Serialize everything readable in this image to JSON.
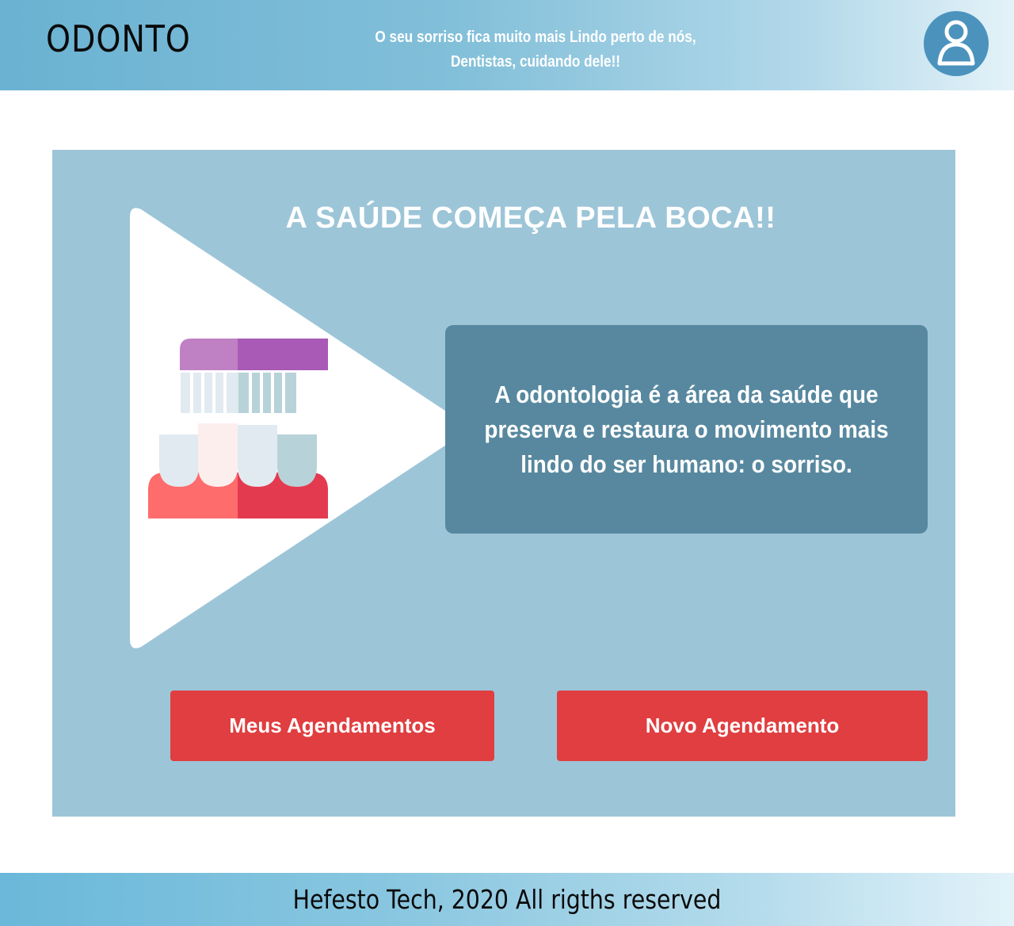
{
  "header": {
    "brand": "ODONTO",
    "tagline_line1": "O seu sorriso fica muito mais Lindo perto de nós,",
    "tagline_line2": "Dentistas, cuidando dele!!",
    "avatar_icon": "user-avatar-icon"
  },
  "main": {
    "headline": "A SAÚDE COMEÇA PELA BOCA!!",
    "illustration_icon": "toothbrush-teeth-icon",
    "info_text": "A odontologia é a área da saúde que preserva e restaura o movimento mais lindo do ser humano: o sorriso.",
    "buttons": {
      "meus": "Meus Agendamentos",
      "novo": "Novo Agendamento"
    }
  },
  "footer": {
    "text": "Hefesto Tech, 2020 All rigths reserved"
  },
  "colors": {
    "header_gradient_start": "#6ab2d2",
    "panel": "#9dc5d8",
    "info_box": "#57889f",
    "button": "#e03e40"
  }
}
